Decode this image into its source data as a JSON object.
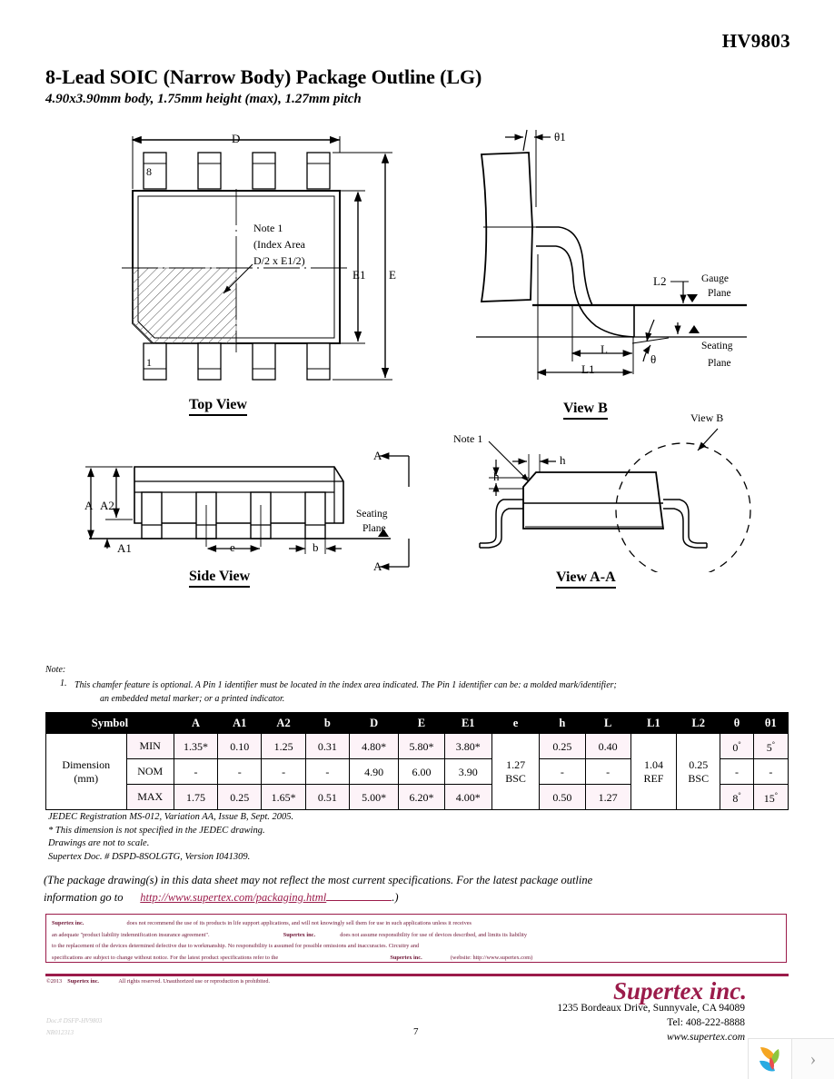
{
  "header": {
    "part_number": "HV9803",
    "title": "8-Lead SOIC (Narrow Body) Package Outline (LG)",
    "subtitle": "4.90x3.90mm body, 1.75mm height (max), 1.27mm pitch"
  },
  "drawings": {
    "top_view": {
      "caption": "Top View",
      "labels": {
        "D": "D",
        "E": "E",
        "E1": "E1",
        "pin8": "8",
        "pin1": "1",
        "note_l1": "Note 1",
        "note_l2": "(Index Area",
        "note_l3": "D/2 x E1/2)"
      }
    },
    "view_b": {
      "caption": "View B",
      "labels": {
        "theta1": "θ1",
        "theta": "θ",
        "L": "L",
        "L1": "L1",
        "L2": "L2",
        "gauge_l1": "Gauge",
        "gauge_l2": "Plane",
        "seating_l1": "Seating",
        "seating_l2": "Plane",
        "callout": "View B"
      }
    },
    "side_view": {
      "caption": "Side View",
      "labels": {
        "A": "A",
        "A2": "A2",
        "A1": "A1",
        "e": "e",
        "b": "b",
        "seating_l1": "Seating",
        "seating_l2": "Plane",
        "section_top": "A",
        "section_bottom": "A"
      }
    },
    "view_aa": {
      "caption": "View A-A",
      "labels": {
        "note1": "Note 1",
        "h_top": "h",
        "h_left": "h",
        "view_b_callout": "View B"
      }
    }
  },
  "note_section": {
    "heading": "Note:",
    "number": "1.",
    "line1": "This chamfer feature is optional.  A Pin 1 identifier must be located in the index area indicated.  The Pin 1 identifier can be: a molded mark/identifier;",
    "line2": "an embedded metal marker; or a printed indicator."
  },
  "table": {
    "headers": [
      "Symbol",
      "A",
      "A1",
      "A2",
      "b",
      "D",
      "E",
      "E1",
      "e",
      "h",
      "L",
      "L1",
      "L2",
      "θ",
      "θ1"
    ],
    "row_group_label_l1": "Dimension",
    "row_group_label_l2": "(mm)",
    "rows": [
      {
        "label": "MIN",
        "A": "1.35*",
        "A1": "0.10",
        "A2": "1.25",
        "b": "0.31",
        "D": "4.80*",
        "E": "5.80*",
        "E1": "3.80*",
        "h": "0.25",
        "L": "0.40",
        "theta": "0",
        "theta_unit": "°",
        "theta1": "5",
        "theta1_unit": "°"
      },
      {
        "label": "NOM",
        "A": "-",
        "A1": "-",
        "A2": "-",
        "b": "-",
        "D": "4.90",
        "E": "6.00",
        "E1": "3.90",
        "h": "-",
        "L": "-",
        "theta": "-",
        "theta_unit": "",
        "theta1": "-",
        "theta1_unit": ""
      },
      {
        "label": "MAX",
        "A": "1.75",
        "A1": "0.25",
        "A2": "1.65*",
        "b": "0.51",
        "D": "5.00*",
        "E": "6.20*",
        "E1": "4.00*",
        "h": "0.50",
        "L": "1.27",
        "theta": "8",
        "theta_unit": "°",
        "theta1": "15",
        "theta1_unit": "°"
      }
    ],
    "merged": {
      "e_l1": "1.27",
      "e_l2": "BSC",
      "L1_l1": "1.04",
      "L1_l2": "REF",
      "L2_l1": "0.25",
      "L2_l2": "BSC"
    }
  },
  "jedec_notes": [
    "JEDEC Registration MS-012, Variation AA, Issue B, Sept. 2005.",
    "* This dimension is not specified in the JEDEC drawing.",
    "Drawings are not to scale.",
    "Supertex Doc. #  DSPD-8SOLGTG, Version I041309."
  ],
  "notice": {
    "line1": "(The package drawing(s) in this data sheet may not reflect the most current specifications.  For the latest package outline",
    "line2_pre": "information go to",
    "link": "http://www.supertex.com/packaging.html",
    "line2_post": ".)"
  },
  "disclaimer": {
    "brand": "Supertex inc.",
    "l1a": "does not recommend the use of its products in life support applications, and will not knowingly sell them for use in such applications unless it receives",
    "l2a": "an adequate \"product liability indemnification insurance agreement\".",
    "l2b": "does not assume responsibility for use of devices described, and limits its liability",
    "l3": "to the replacement of the devices determined defective due to workmanship.  No responsibility is assumed for possible omissions and inaccuracies.  Circuitry and",
    "l4a": "specifications are subject to change without notice.  For the latest product specifications refer to the",
    "l4b": "(website: http://www.supertex.com)"
  },
  "footer": {
    "copyright_year": "©2013",
    "copyright_brand": "Supertex inc.",
    "copyright_text": "All rights reserved.  Unauthorized use or reproduction is prohibited.",
    "doc_code": "Doc.# DSFP-HV9803",
    "doc_rev": "NR012313",
    "page_number": "7",
    "company": "Supertex inc.",
    "address": "1235 Bordeaux Drive, Sunnyvale, CA 94089",
    "tel": "Tel: 408-222-8888",
    "website": "www.supertex.com"
  },
  "viewer": {
    "next_chevron": "›"
  },
  "colors": {
    "brand": "#9b1b4a",
    "accent_dark": "#6d1233",
    "table_header_bg": "#000000",
    "row_tint": "#fdf3f8"
  }
}
